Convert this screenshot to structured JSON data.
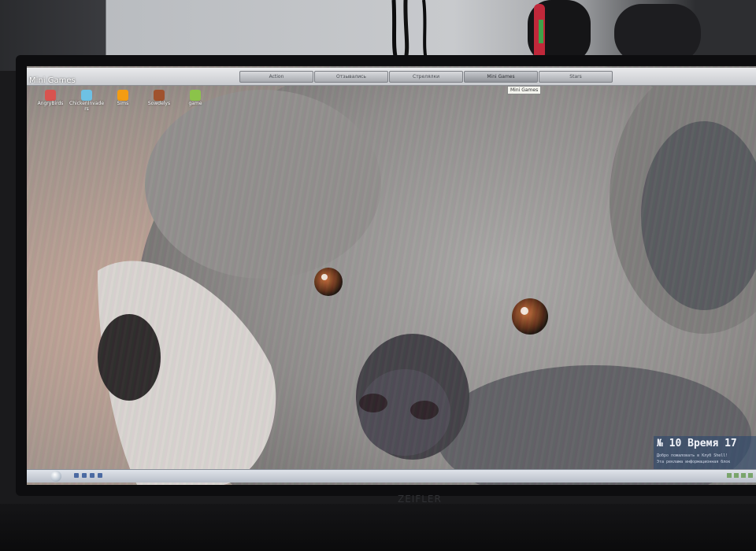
{
  "desktop": {
    "window_title": "Mini Games",
    "menu_tabs": [
      {
        "label": "Action"
      },
      {
        "label": "Отзывались"
      },
      {
        "label": "Стрелялки"
      },
      {
        "label": "Mini Games"
      },
      {
        "label": "Stars"
      }
    ],
    "active_tab": "Mini Games",
    "tooltip": "Mini Games",
    "icons": [
      {
        "label": "AngryBirds",
        "icon": "angry-bird-icon",
        "color": "#d9534f"
      },
      {
        "label": "ChickenInvaders",
        "icon": "chicken-icon",
        "color": "#6ec1e4"
      },
      {
        "label": "Sims",
        "icon": "person-icon",
        "color": "#f39c12"
      },
      {
        "label": "Sowdelys",
        "icon": "barrel-icon",
        "color": "#a0522d"
      },
      {
        "label": "game",
        "icon": "game-icon",
        "color": "#8bc34a"
      }
    ]
  },
  "info_widget": {
    "number_line": "№ 10  Время 17",
    "line1": "Добро пожаловать в Клуб Shell!",
    "line2": "Эта реклама информационная блок"
  },
  "monitor": {
    "brand": "ZEIFLER"
  }
}
